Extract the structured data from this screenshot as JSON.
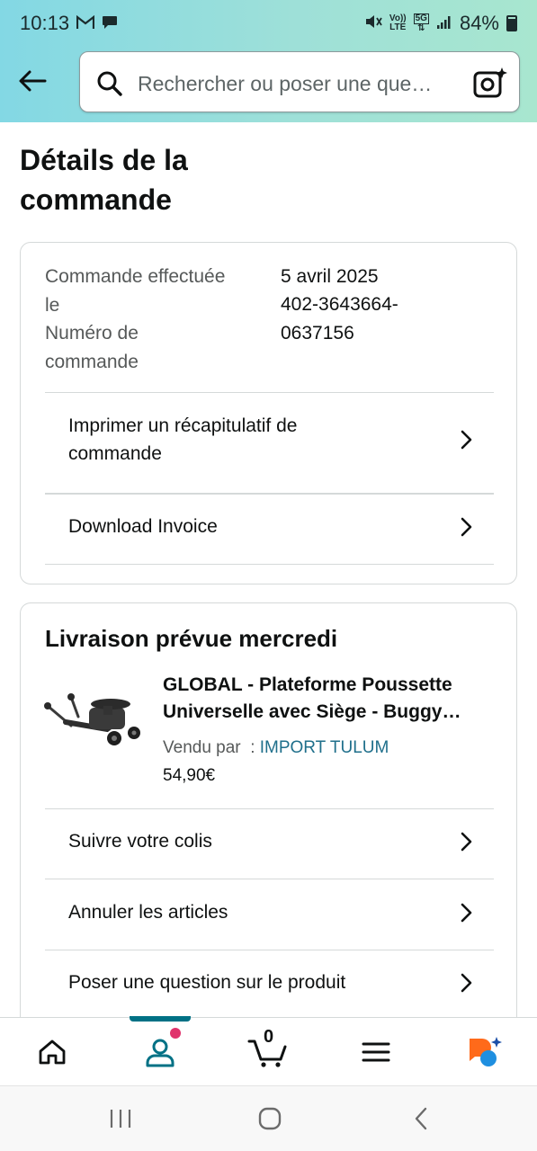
{
  "status_bar": {
    "time": "10:13",
    "battery": "84%",
    "volte_top": "Vo))",
    "volte_bottom": "LTE",
    "network": "5G"
  },
  "header": {
    "search_placeholder": "Rechercher ou poser une que…",
    "icons": [
      "back-arrow-icon",
      "search-icon",
      "camera-search-icon"
    ]
  },
  "page": {
    "title_line1": "Détails de la",
    "title_line2": "commande"
  },
  "order_summary": {
    "date_label_line1": "Commande effectuée",
    "date_label_line2": "le",
    "date_value": "5 avril 2025",
    "number_label_line1": "Numéro de",
    "number_label_line2": "commande",
    "number_value_line1": "402-3643664-",
    "number_value_line2": "0637156",
    "actions": [
      {
        "label_line1": "Imprimer un récapitulatif de",
        "label_line2": "commande"
      },
      {
        "label": "Download Invoice"
      }
    ]
  },
  "delivery": {
    "title": "Livraison prévue mercredi",
    "product": {
      "title_line1": "GLOBAL - Plateforme Poussette",
      "title_line2": "Universelle avec Siège - Buggy…",
      "seller_prefix": "Vendu par  : ",
      "seller": "IMPORT TULUM",
      "price": "54,90€"
    },
    "actions": [
      {
        "label": "Suivre votre colis"
      },
      {
        "label": "Annuler les articles"
      },
      {
        "label": "Poser une question sur le produit"
      }
    ]
  },
  "bottom_nav": {
    "items": [
      "home-icon",
      "account-icon",
      "cart-icon",
      "menu-icon",
      "rufus-assistant-icon"
    ],
    "cart_count": "0",
    "active": "account-icon"
  },
  "colors": {
    "header_gradient_start": "#83d8e4",
    "header_gradient_end": "#a8e6cf",
    "link": "#1f6f8b",
    "accent": "#007185",
    "badge": "#e0336c"
  }
}
